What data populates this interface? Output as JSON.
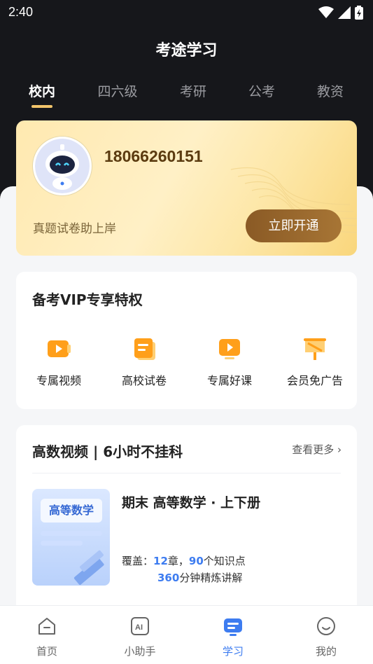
{
  "status_bar": {
    "time": "2:40"
  },
  "app": {
    "title": "考途学习"
  },
  "tabs": [
    {
      "label": "校内",
      "active": true
    },
    {
      "label": "四六级",
      "active": false
    },
    {
      "label": "考研",
      "active": false
    },
    {
      "label": "公考",
      "active": false
    },
    {
      "label": "教资",
      "active": false
    }
  ],
  "vip_card": {
    "phone": "18066260151",
    "slogan": "真题试卷助上岸",
    "button_label": "立即开通"
  },
  "privileges": {
    "title": "备考VIP专享特权",
    "items": [
      {
        "label": "专属视频",
        "icon": "video-icon"
      },
      {
        "label": "高校试卷",
        "icon": "paper-icon"
      },
      {
        "label": "专属好课",
        "icon": "course-icon"
      },
      {
        "label": "会员免广告",
        "icon": "no-ad-icon"
      }
    ]
  },
  "video_section": {
    "title": "高数视频 | 6小时不挂科",
    "more_label": "查看更多",
    "course": {
      "cover_tag": "高等数学",
      "title": "期末 高等数学 · 上下册",
      "coverage_prefix": "覆盖：",
      "chapters": "12",
      "chapters_unit": "章，",
      "points": "90",
      "points_unit": "个知识点",
      "minutes": "360",
      "minutes_unit": "分钟精炼讲解"
    }
  },
  "bottom_nav": [
    {
      "label": "首页",
      "icon": "home-icon",
      "active": false
    },
    {
      "label": "小助手",
      "icon": "ai-assistant-icon",
      "active": false
    },
    {
      "label": "学习",
      "icon": "study-icon",
      "active": true
    },
    {
      "label": "我的",
      "icon": "profile-icon",
      "active": false
    }
  ],
  "colors": {
    "accent": "#3d7cf0",
    "gold_button": "#8a5a25",
    "dark_header": "#16171b",
    "icon_orange": "#ff9f1a"
  }
}
